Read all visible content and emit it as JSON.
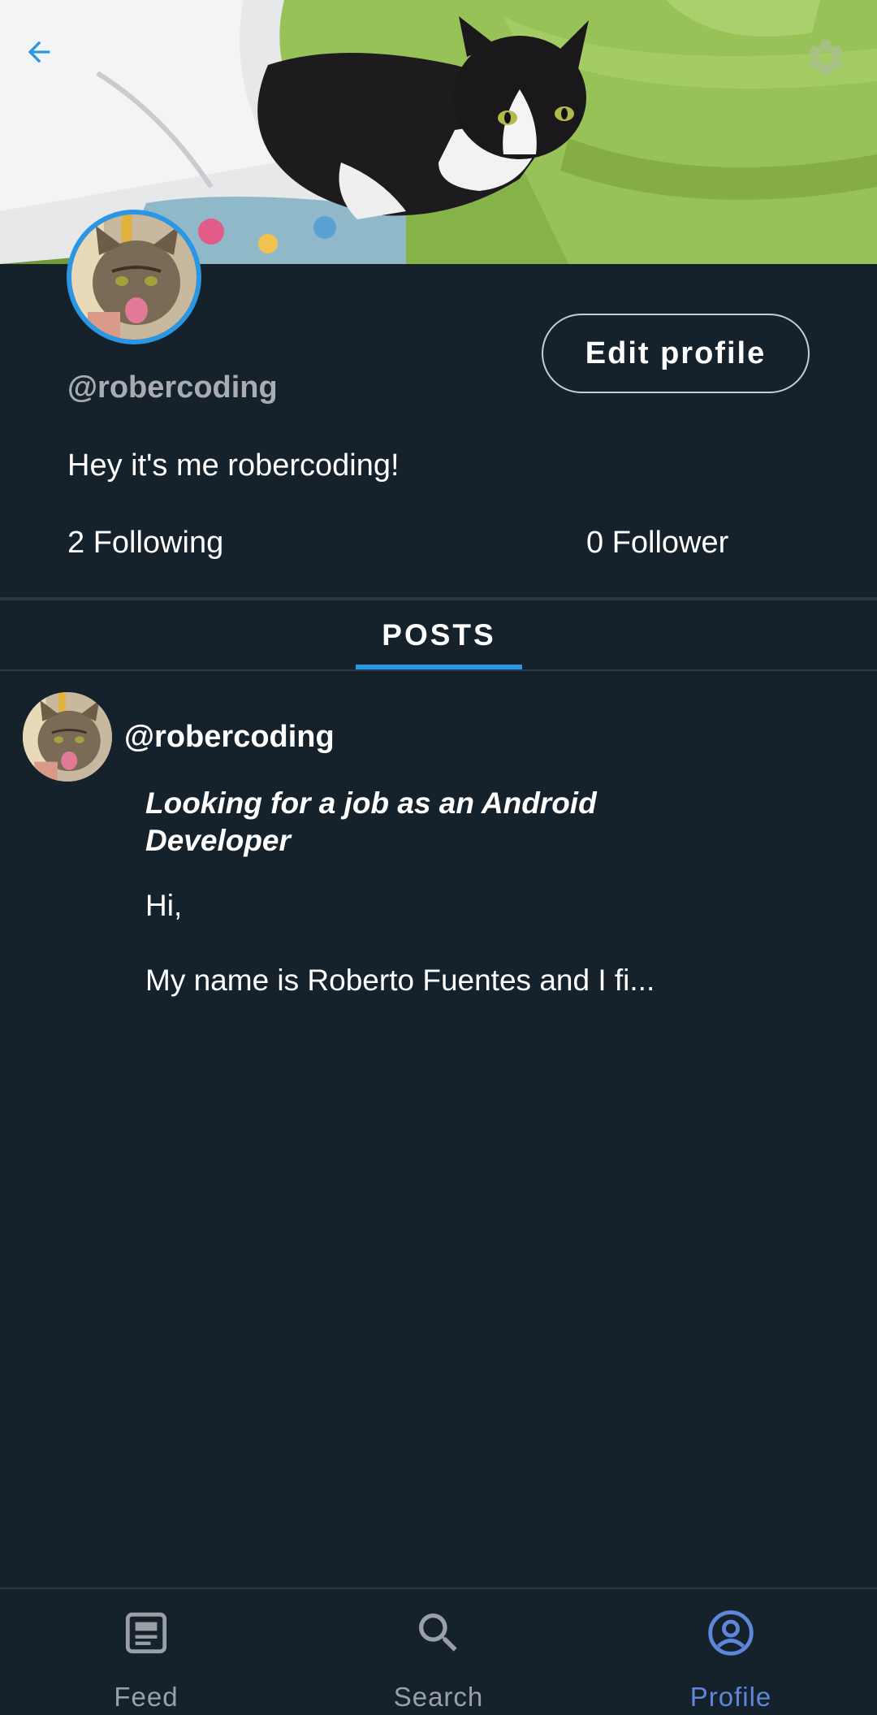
{
  "header": {
    "back_icon": "arrow-back-icon",
    "settings_icon": "gear-icon",
    "accent_color": "#2b97e4"
  },
  "profile": {
    "handle": "@robercoding",
    "bio": "Hey it's me robercoding!",
    "following": "2 Following",
    "followers": "0 Follower",
    "edit_button": "Edit profile"
  },
  "tabs": {
    "posts": "POSTS"
  },
  "post": {
    "author": "@robercoding",
    "title": "Looking for a job as an Android Developer",
    "body": "Hi,\n\nMy name is Roberto Fuentes and I fi..."
  },
  "bottom_nav": {
    "items": [
      {
        "label": "Feed",
        "icon": "feed-icon",
        "active": false
      },
      {
        "label": "Search",
        "icon": "search-icon",
        "active": false
      },
      {
        "label": "Profile",
        "icon": "account-circle-icon",
        "active": true
      }
    ],
    "active_color": "#5f86d8",
    "inactive_color": "#9aa0a5"
  }
}
